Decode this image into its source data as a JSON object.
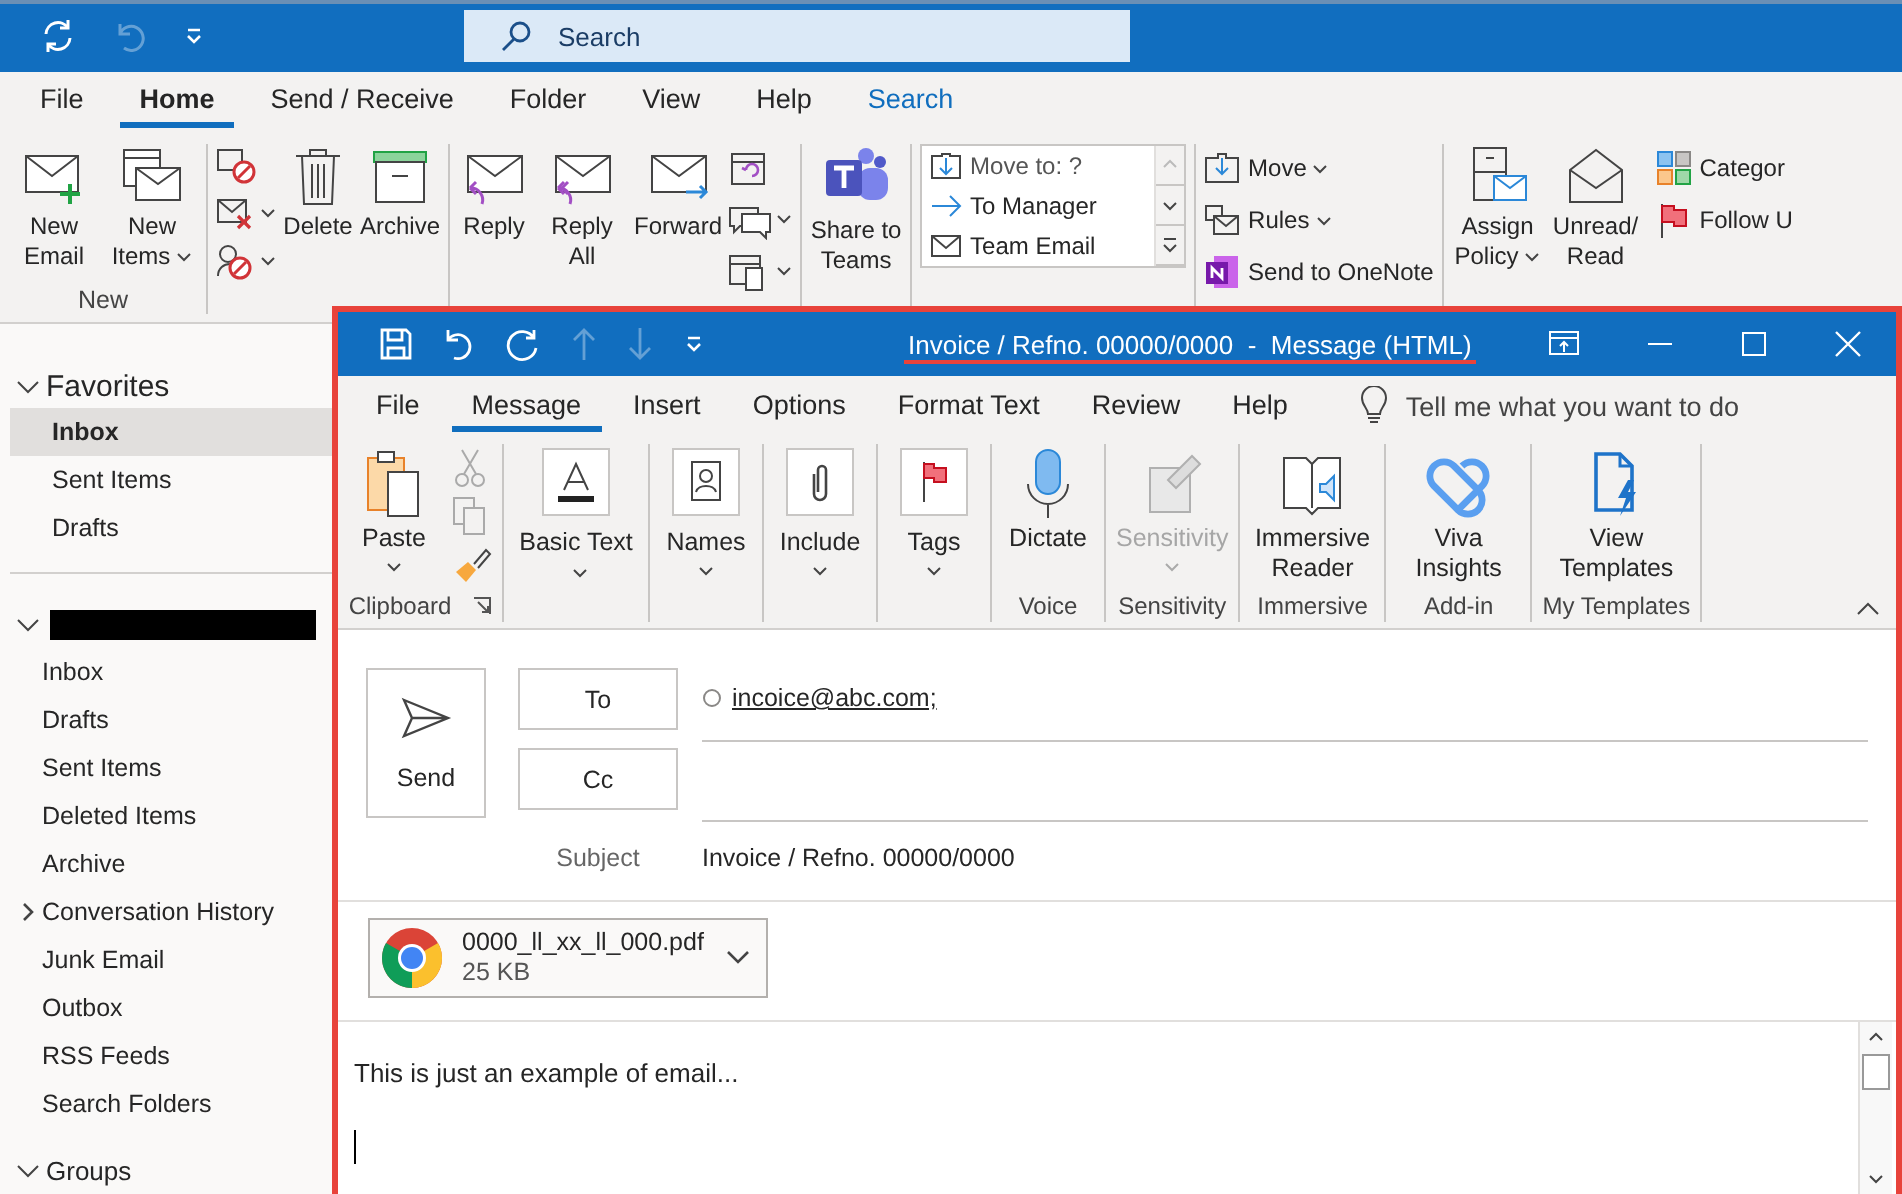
{
  "main": {
    "search": {
      "placeholder": "Search"
    },
    "quick_access": [
      {
        "kind": "sync",
        "disabled": false
      },
      {
        "kind": "undo",
        "disabled": true
      },
      {
        "kind": "customize",
        "disabled": false
      }
    ],
    "tabs": [
      {
        "label": "File",
        "selected": false,
        "kind": "normal"
      },
      {
        "label": "Home",
        "selected": true,
        "kind": "normal"
      },
      {
        "label": "Send / Receive",
        "selected": false,
        "kind": "normal"
      },
      {
        "label": "Folder",
        "selected": false,
        "kind": "normal"
      },
      {
        "label": "View",
        "selected": false,
        "kind": "normal"
      },
      {
        "label": "Help",
        "selected": false,
        "kind": "normal"
      },
      {
        "label": "Search",
        "selected": false,
        "kind": "contextual"
      }
    ],
    "ribbon": [
      {
        "label": "New",
        "items": [
          {
            "label": "New Email",
            "menu": false
          },
          {
            "label": "New Items",
            "menu": true
          }
        ]
      },
      {
        "items": [
          {
            "label": "Delete",
            "menu": false
          },
          {
            "label": "Archive",
            "menu": false
          }
        ]
      },
      {
        "items": [
          {
            "label": "Reply",
            "menu": false
          },
          {
            "label": "Reply All",
            "menu": false
          },
          {
            "label": "Forward",
            "menu": false
          }
        ]
      },
      {
        "items": [
          {
            "label": "Share to Teams",
            "menu": false
          }
        ]
      },
      {
        "items": [
          {
            "label": "Move to: ?"
          },
          {
            "label": "To Manager"
          },
          {
            "label": "Team Email"
          }
        ]
      },
      {
        "items": [
          {
            "label": "Move",
            "menu": true
          },
          {
            "label": "Rules",
            "menu": true
          },
          {
            "label": "Send to OneNote",
            "menu": false
          }
        ]
      },
      {
        "items": [
          {
            "label": "Assign Policy",
            "menu": true
          },
          {
            "label": "Unread/ Read",
            "menu": false
          },
          {
            "label": "Categor"
          },
          {
            "label": "Follow U"
          }
        ]
      }
    ]
  },
  "sidebar": {
    "favorites": {
      "label": "Favorites",
      "expanded": true,
      "items": [
        {
          "label": "Inbox",
          "selected": true
        },
        {
          "label": "Sent Items",
          "selected": false
        },
        {
          "label": "Drafts",
          "selected": false
        }
      ]
    },
    "account": {
      "expanded": true,
      "items": [
        {
          "label": "Inbox",
          "kind": "folder"
        },
        {
          "label": "Drafts",
          "kind": "folder"
        },
        {
          "label": "Sent Items",
          "kind": "folder"
        },
        {
          "label": "Deleted Items",
          "kind": "folder"
        },
        {
          "label": "Archive",
          "kind": "folder"
        },
        {
          "label": "Conversation History",
          "kind": "parent"
        },
        {
          "label": "Junk Email",
          "kind": "folder"
        },
        {
          "label": "Outbox",
          "kind": "folder"
        },
        {
          "label": "RSS Feeds",
          "kind": "folder"
        },
        {
          "label": "Search Folders",
          "kind": "folder"
        }
      ]
    },
    "groups": {
      "label": "Groups",
      "expanded": true
    }
  },
  "message_window": {
    "title": "Invoice / Refno. 00000/0000  -  Message (HTML)",
    "quick_access": [
      {
        "kind": "save",
        "disabled": false
      },
      {
        "kind": "undo",
        "disabled": false
      },
      {
        "kind": "redo",
        "disabled": false
      },
      {
        "kind": "up",
        "disabled": true
      },
      {
        "kind": "down",
        "disabled": true
      },
      {
        "kind": "customize",
        "disabled": false
      }
    ],
    "tabs": [
      {
        "label": "File",
        "selected": false
      },
      {
        "label": "Message",
        "selected": true
      },
      {
        "label": "Insert",
        "selected": false
      },
      {
        "label": "Options",
        "selected": false
      },
      {
        "label": "Format Text",
        "selected": false
      },
      {
        "label": "Review",
        "selected": false
      },
      {
        "label": "Help",
        "selected": false
      }
    ],
    "tell_me": "Tell me what you want to do",
    "ribbon": [
      {
        "label": "Clipboard",
        "items": [
          {
            "label": "Paste",
            "menu": true,
            "disabled": false
          }
        ]
      },
      {
        "items": [
          {
            "label": "Basic Text",
            "menu": true,
            "disabled": false
          }
        ]
      },
      {
        "items": [
          {
            "label": "Names",
            "menu": true,
            "disabled": false
          }
        ]
      },
      {
        "items": [
          {
            "label": "Include",
            "menu": true,
            "disabled": false
          }
        ]
      },
      {
        "items": [
          {
            "label": "Tags",
            "menu": true,
            "disabled": false
          }
        ]
      },
      {
        "label": "Voice",
        "items": [
          {
            "label": "Dictate",
            "menu": false,
            "disabled": false
          }
        ]
      },
      {
        "label": "Sensitivity",
        "items": [
          {
            "label": "Sensitivity",
            "menu": true,
            "disabled": true
          }
        ]
      },
      {
        "label": "Immersive",
        "items": [
          {
            "label": "Immersive Reader",
            "menu": false,
            "disabled": false
          }
        ]
      },
      {
        "label": "Add-in",
        "items": [
          {
            "label": "Viva Insights",
            "menu": false,
            "disabled": false
          }
        ]
      },
      {
        "label": "My Templates",
        "items": [
          {
            "label": "View Templates",
            "menu": false,
            "disabled": false
          }
        ]
      }
    ],
    "send": "Send",
    "to_label": "To",
    "cc_label": "Cc",
    "recipient": "incoice@abc.com;",
    "subject_label": "Subject",
    "subject": "Invoice / Refno. 00000/0000",
    "attachment": {
      "name": "0000_ll_xx_ll_000.pdf",
      "size": "25 KB"
    },
    "body": "This is just an example of email..."
  }
}
